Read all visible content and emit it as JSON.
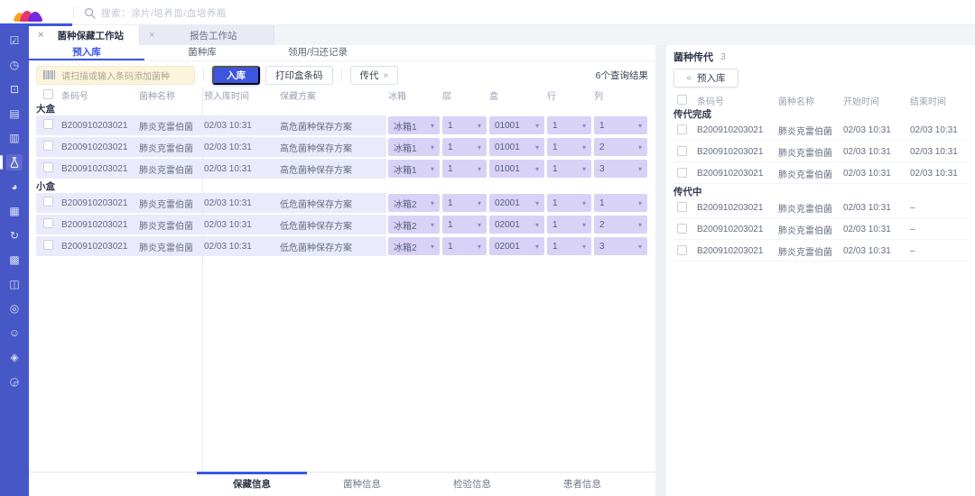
{
  "topbar": {
    "search_placeholder": "搜索：涂片/培养皿/血培养瓶"
  },
  "window_tabs": [
    {
      "label": "菌种保藏工作站",
      "close": "×",
      "active": true
    },
    {
      "label": "报告工作站",
      "close": "×",
      "active": false
    }
  ],
  "subtabs": [
    "预入库",
    "菌种库",
    "领用/归还记录"
  ],
  "controls": {
    "scan_placeholder": "请扫描或输入条码添加菌种",
    "stock_in": "入库",
    "print_box_barcode": "打印盒条码",
    "passage": "传代",
    "passage_chevron": "»",
    "result_count": "6个查询结果"
  },
  "left_table": {
    "headers": [
      "条码号",
      "菌种名称",
      "预入库时间",
      "保藏方案",
      "冰箱",
      "层",
      "盒",
      "行",
      "列"
    ],
    "groups": [
      {
        "label": "大盒",
        "rows": [
          {
            "code": "B200910203021",
            "name": "肺炎克雷伯菌",
            "time": "02/03 10:31",
            "plan": "高危菌种保存方案",
            "fridge": "冰箱1",
            "layer": "1",
            "box": "01001",
            "row": "1",
            "col": "1"
          },
          {
            "code": "B200910203021",
            "name": "肺炎克雷伯菌",
            "time": "02/03 10:31",
            "plan": "高危菌种保存方案",
            "fridge": "冰箱1",
            "layer": "1",
            "box": "01001",
            "row": "1",
            "col": "2"
          },
          {
            "code": "B200910203021",
            "name": "肺炎克雷伯菌",
            "time": "02/03 10:31",
            "plan": "高危菌种保存方案",
            "fridge": "冰箱1",
            "layer": "1",
            "box": "01001",
            "row": "1",
            "col": "3"
          }
        ]
      },
      {
        "label": "小盒",
        "rows": [
          {
            "code": "B200910203021",
            "name": "肺炎克雷伯菌",
            "time": "02/03 10:31",
            "plan": "低危菌种保存方案",
            "fridge": "冰箱2",
            "layer": "1",
            "box": "02001",
            "row": "1",
            "col": "1"
          },
          {
            "code": "B200910203021",
            "name": "肺炎克雷伯菌",
            "time": "02/03 10:31",
            "plan": "低危菌种保存方案",
            "fridge": "冰箱2",
            "layer": "1",
            "box": "02001",
            "row": "1",
            "col": "2"
          },
          {
            "code": "B200910203021",
            "name": "肺炎克雷伯菌",
            "time": "02/03 10:31",
            "plan": "低危菌种保存方案",
            "fridge": "冰箱2",
            "layer": "1",
            "box": "02001",
            "row": "1",
            "col": "3"
          }
        ]
      }
    ]
  },
  "right_panel": {
    "title": "菌种传代",
    "count": "3",
    "back_chevron": "«",
    "back_button": "预入库",
    "headers": [
      "条码号",
      "菌种名称",
      "开始时间",
      "结束时间"
    ],
    "groups": [
      {
        "label": "传代完成",
        "rows": [
          {
            "code": "B200910203021",
            "name": "肺炎克雷伯菌",
            "start": "02/03 10:31",
            "end": "02/03 10:31"
          },
          {
            "code": "B200910203021",
            "name": "肺炎克雷伯菌",
            "start": "02/03 10:31",
            "end": "02/03 10:31"
          },
          {
            "code": "B200910203021",
            "name": "肺炎克雷伯菌",
            "start": "02/03 10:31",
            "end": "02/03 10:31"
          }
        ]
      },
      {
        "label": "传代中",
        "rows": [
          {
            "code": "B200910203021",
            "name": "肺炎克雷伯菌",
            "start": "02/03 10:31",
            "end": "–"
          },
          {
            "code": "B200910203021",
            "name": "肺炎克雷伯菌",
            "start": "02/03 10:31",
            "end": "–"
          },
          {
            "code": "B200910203021",
            "name": "肺炎克雷伯菌",
            "start": "02/03 10:31",
            "end": "–"
          }
        ]
      }
    ]
  },
  "footer_tabs": [
    {
      "label": "保藏信息",
      "active": true
    },
    {
      "label": "菌种信息",
      "active": false
    },
    {
      "label": "检验信息",
      "active": false
    },
    {
      "label": "患者信息",
      "active": false
    }
  ],
  "sidebar": {
    "icons": [
      {
        "name": "checklist-icon",
        "glyph": "☑"
      },
      {
        "name": "clock-icon",
        "glyph": "◷"
      },
      {
        "name": "camera-icon",
        "glyph": "⊡"
      },
      {
        "name": "report-icon",
        "glyph": "▤"
      },
      {
        "name": "card-icon",
        "glyph": "▥"
      },
      {
        "name": "flask-icon",
        "glyph": "",
        "active": true
      },
      {
        "name": "pie-chart-icon",
        "glyph": "◕"
      },
      {
        "name": "form-icon",
        "glyph": "▦"
      },
      {
        "name": "history-icon",
        "glyph": "↻"
      },
      {
        "name": "barcode-icon",
        "glyph": "▩"
      },
      {
        "name": "image-icon",
        "glyph": "◫"
      },
      {
        "name": "target-icon",
        "glyph": "◎"
      },
      {
        "name": "smiley-icon",
        "glyph": "☺"
      },
      {
        "name": "badge-icon",
        "glyph": "◈"
      },
      {
        "name": "compass-icon",
        "glyph": "◶"
      }
    ]
  },
  "colors": {
    "accent_blue": "#3d56e0",
    "sidebar_blue": "#4857c6",
    "row_highlight": "#e9eafb",
    "dropdown_fill": "#d8d2f6",
    "scan_input_bg": "#fcf5dc",
    "logo_orange": "#f7a51d",
    "logo_magenta": "#e8356f",
    "logo_purple": "#7427e0"
  }
}
